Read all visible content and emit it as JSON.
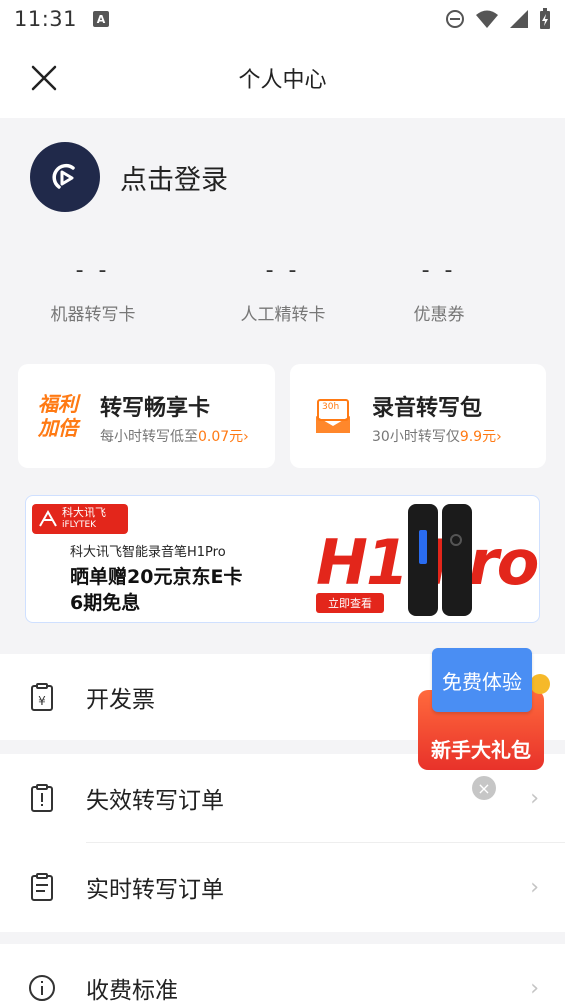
{
  "status_bar": {
    "time": "11:31",
    "notification_badge": "A"
  },
  "nav": {
    "title": "个人中心",
    "close_icon": "close-icon"
  },
  "profile": {
    "login_text": "点击登录"
  },
  "stats": [
    {
      "value": "- -",
      "label": "机器转写卡"
    },
    {
      "value": "- -",
      "label": "人工精转卡"
    },
    {
      "value": "- -",
      "label": "优惠券"
    }
  ],
  "cards": {
    "left": {
      "badge_line1": "福利",
      "badge_line2": "加倍",
      "title": "转写畅享卡",
      "sub_prefix": "每小时转写低至",
      "sub_highlight": "0.07元",
      "chevron": "›"
    },
    "right": {
      "icon_text": "30h",
      "title": "录音转写包",
      "sub_prefix": "30小时转写仅",
      "sub_highlight": "9.9元",
      "chevron": "›"
    }
  },
  "banner": {
    "logo_cn": "科大讯飞",
    "logo_en": "iFLYTEK",
    "subtitle": "科大讯飞智能录音笔H1Pro",
    "line1": "晒单赠20元京东E卡",
    "line2": "6期免息",
    "product": "H1 Pro",
    "cta": "立即查看"
  },
  "menu": {
    "invoice": "开发票",
    "expired_orders": "失效转写订单",
    "realtime_orders": "实时转写订单",
    "pricing": "收费标准",
    "chevron": "›"
  },
  "gift_popup": {
    "tag": "免费体验",
    "label": "新手大礼包",
    "close": "×"
  },
  "colors": {
    "accent": "#ff7a14",
    "brand_red": "#e3261b",
    "avatar_bg": "#20294a",
    "gift_blue": "#4a8ef3"
  }
}
